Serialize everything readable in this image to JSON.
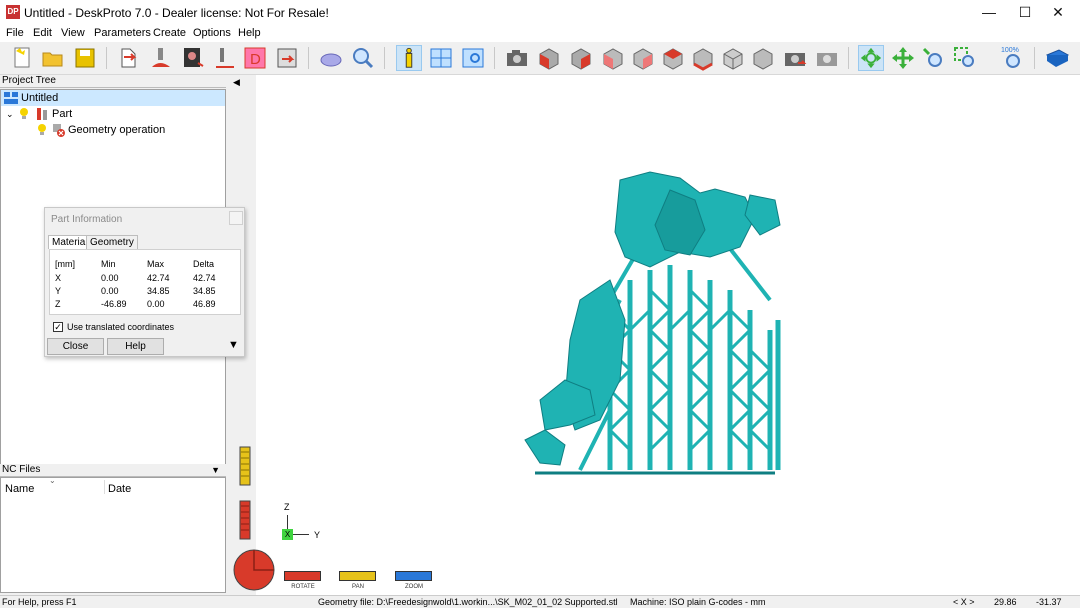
{
  "window": {
    "title": "Untitled - DeskProto 7.0 - Dealer license: Not For Resale!",
    "icon_text": "DP",
    "controls": {
      "minimize": "—",
      "maximize": "☐",
      "close": "✕"
    }
  },
  "menu": [
    "File",
    "Edit",
    "View",
    "Parameters",
    "Create",
    "Options",
    "Help"
  ],
  "colors": {
    "model": "#1fb3b3",
    "model_dark": "#0f7e82",
    "accent_selected": "#cce4f7"
  },
  "toolbar": {
    "icons": [
      "new-file-icon",
      "open-folder-icon",
      "save-icon",
      "import-geometry-icon",
      "toolpath-icon",
      "image-icon",
      "vector-icon",
      "drilling-icon",
      "nc-file-icon",
      "calculate-icon",
      "preview-icon",
      "info-icon",
      "layout-icon",
      "view-icon",
      "camera-icon",
      "view-front-icon",
      "view-back-icon",
      "view-left-icon",
      "view-right-icon",
      "view-top-icon",
      "view-bottom-icon",
      "view-iso-icon",
      "view-iso2-icon",
      "reset-view-icon",
      "capture-icon",
      "rotate-icon",
      "pan-icon",
      "zoom-icon",
      "zoom-window-icon",
      "zoom-100-icon",
      "help-book-icon"
    ],
    "zoom_100_label": "100%"
  },
  "project_tree": {
    "header": "Project Tree",
    "items": [
      {
        "label": "Untitled",
        "level": 0
      },
      {
        "label": "Part",
        "level": 1
      },
      {
        "label": "Geometry operation",
        "level": 2
      }
    ]
  },
  "nc_files": {
    "header": "NC Files",
    "columns": [
      "Name",
      "Date"
    ]
  },
  "part_info": {
    "title": "Part Information",
    "tabs": [
      "Material",
      "Geometry"
    ],
    "columns": [
      "[mm]",
      "Min",
      "Max",
      "Delta"
    ],
    "rows": [
      {
        "axis": "X",
        "min": "0.00",
        "max": "42.74",
        "delta": "42.74"
      },
      {
        "axis": "Y",
        "min": "0.00",
        "max": "34.85",
        "delta": "34.85"
      },
      {
        "axis": "Z",
        "min": "-46.89",
        "max": "0.00",
        "delta": "46.89"
      }
    ],
    "checkbox_label": "Use translated coordinates",
    "checkbox_checked": true,
    "close_label": "Close",
    "help_label": "Help"
  },
  "axes": {
    "z": "Z",
    "y": "Y",
    "x_marker": "X"
  },
  "modes": [
    {
      "label": "ROTATE",
      "color": "#d83a2a"
    },
    {
      "label": "PAN",
      "color": "#e6c21a"
    },
    {
      "label": "ZOOM",
      "color": "#2a78d8"
    }
  ],
  "status": {
    "help": "For Help, press F1",
    "geometry_file": "Geometry file: D:\\Freedesignwold\\1.workin...\\SK_M02_01_02 Supported.stl",
    "machine": "Machine: ISO plain G-codes - mm",
    "coord_label": "< X >",
    "coord_x": "29.86",
    "coord_y": "-31.37"
  }
}
